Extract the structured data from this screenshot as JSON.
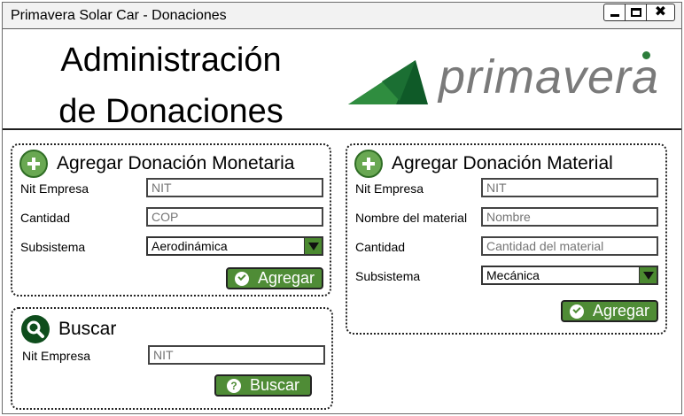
{
  "window": {
    "title": "Primavera Solar Car - Donaciones",
    "controls": {
      "close_glyph": "✖"
    }
  },
  "header": {
    "title_line1": "Administración",
    "title_line2": "de Donaciones",
    "logo_text": "primavera"
  },
  "monetaria": {
    "heading": "Agregar Donación Monetaria",
    "nit_label": "Nit Empresa",
    "nit_placeholder": "NIT",
    "cantidad_label": "Cantidad",
    "cantidad_placeholder": "COP",
    "subsistema_label": "Subsistema",
    "subsistema_value": "Aerodinámica",
    "button_label": "Agregar"
  },
  "buscar": {
    "heading": "Buscar",
    "nit_label": "Nit Empresa",
    "nit_placeholder": "NIT",
    "button_label": "Buscar",
    "button_glyph": "?"
  },
  "material": {
    "heading": "Agregar Donación Material",
    "nit_label": "Nit Empresa",
    "nit_placeholder": "NIT",
    "nombre_label": "Nombre del material",
    "nombre_placeholder": "Nombre",
    "cantidad_label": "Cantidad",
    "cantidad_placeholder": "Cantidad del material",
    "subsistema_label": "Subsistema",
    "subsistema_value": "Mecánica",
    "button_label": "Agregar"
  },
  "colors": {
    "accent_green": "#4f8c36",
    "dark_green": "#0e4d1c",
    "logo_gray": "#7a7a7a"
  },
  "icons": [
    "plus-icon",
    "search-icon",
    "check-icon",
    "question-icon",
    "minimize-icon",
    "maximize-icon",
    "close-icon",
    "dropdown-arrow-icon",
    "primavera-logo-icon"
  ]
}
